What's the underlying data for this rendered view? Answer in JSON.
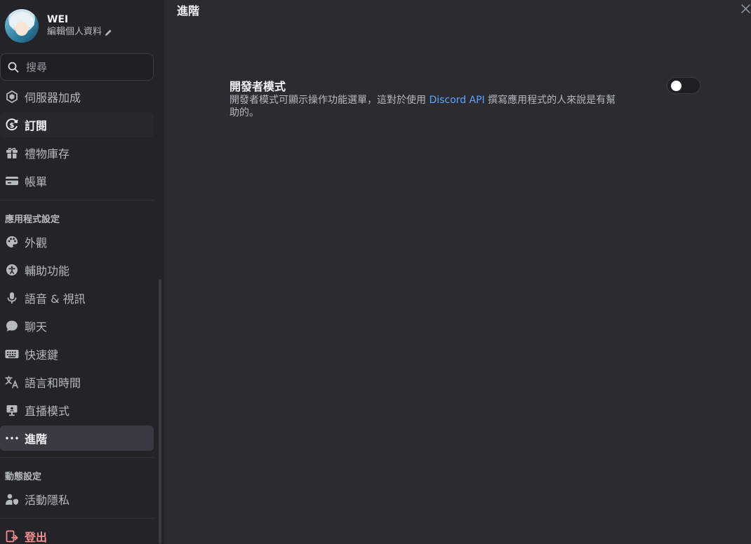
{
  "profile": {
    "username": "WEI",
    "edit_label": "編輯個人資料"
  },
  "search": {
    "placeholder": "搜尋"
  },
  "nav": {
    "server_boost": "伺服器加成",
    "subscriptions": "訂閱",
    "gift_inventory": "禮物庫存",
    "billing": "帳單",
    "app_settings_header": "應用程式設定",
    "appearance": "外觀",
    "accessibility": "輔助功能",
    "voice_video": "語音 & 視訊",
    "chat": "聊天",
    "keybinds": "快速鍵",
    "language_time": "語言和時間",
    "streamer_mode": "直播模式",
    "advanced": "進階",
    "activity_settings_header": "動態設定",
    "activity_privacy": "活動隱私",
    "logout": "登出"
  },
  "main": {
    "title": "進階",
    "developer_mode": {
      "title": "開發者模式",
      "desc_before": "開發者模式可顯示操作功能選單，這對於使用 ",
      "link": "Discord API",
      "desc_after": " 撰寫應用程式的人來說是有幫助的。",
      "enabled": false
    }
  },
  "colors": {
    "accent_link": "#5ea6ff",
    "danger": "#f38e8f",
    "background": "#2b2b31",
    "sidebar": "#232328"
  },
  "icons": {
    "search": "search-icon",
    "boost": "server-boost-icon",
    "subscriptions": "nitro-coin-icon",
    "gift": "gift-icon",
    "billing": "credit-card-icon",
    "appearance": "palette-icon",
    "accessibility": "accessibility-icon",
    "voice": "microphone-icon",
    "chat": "chat-bubble-icon",
    "keybinds": "keyboard-icon",
    "language": "translate-icon",
    "streamer": "monitor-icon",
    "advanced": "ellipsis-icon",
    "privacy": "user-shield-icon",
    "logout": "logout-icon",
    "close": "close-icon",
    "edit": "pencil-icon"
  }
}
